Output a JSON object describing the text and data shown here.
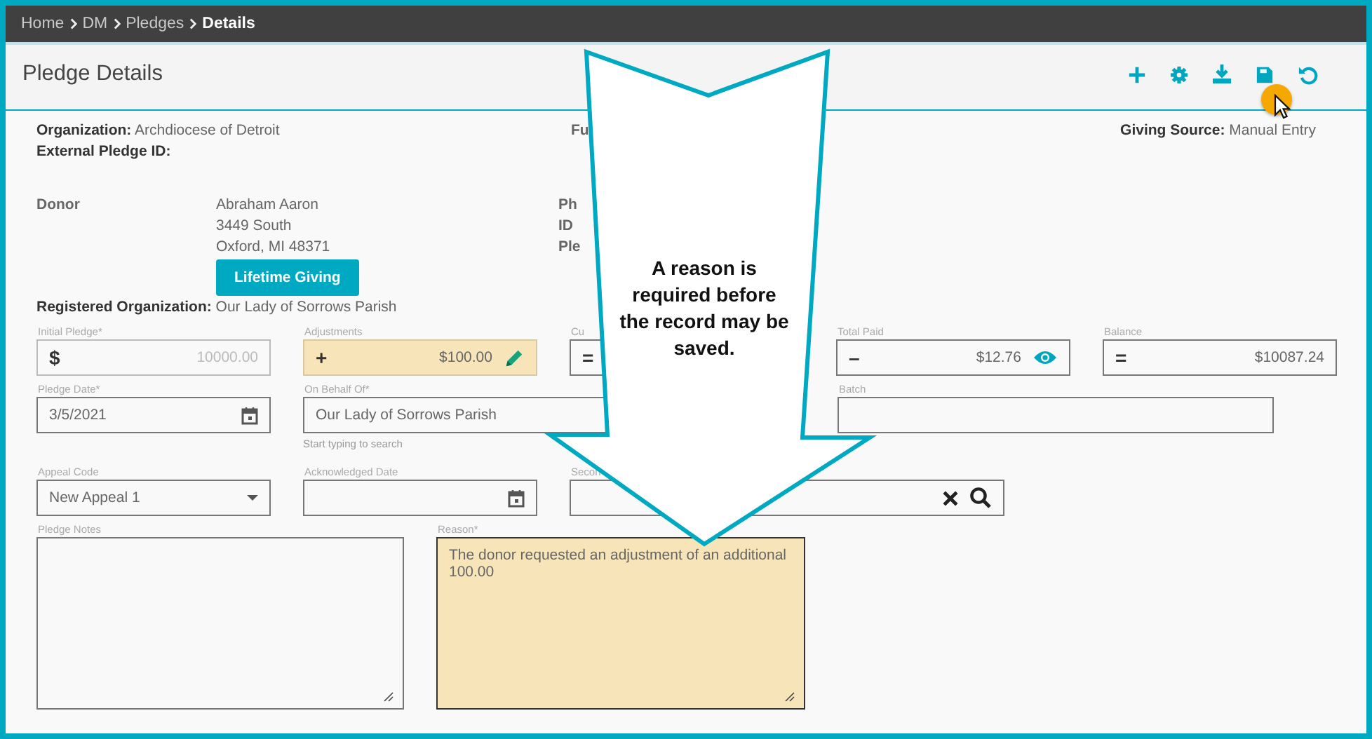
{
  "breadcrumb": [
    {
      "label": "Home",
      "current": false
    },
    {
      "label": "DM",
      "current": false
    },
    {
      "label": "Pledges",
      "current": false
    },
    {
      "label": "Details",
      "current": true
    }
  ],
  "page_title": "Pledge Details",
  "summary": {
    "organization": {
      "label": "Organization:",
      "value": "Archdiocese of Detroit"
    },
    "external_pledge_id": {
      "label": "External Pledge ID:"
    },
    "column_2_label": "Fu",
    "giving_source": {
      "label": "Giving Source:",
      "value": "Manual Entry"
    }
  },
  "donor": {
    "label": "Donor",
    "lines": [
      "Abraham Aaron",
      "3449 South",
      "Oxford, MI 48371"
    ],
    "button": "Lifetime Giving",
    "column_2_labels": [
      "Ph",
      "ID",
      "Ple"
    ]
  },
  "registered_organization": {
    "label": "Registered Organization:",
    "value": "Our Lady of Sorrows Parish"
  },
  "form_rows": [
    [
      {
        "kind": "amount",
        "label": "Initial Pledge*",
        "prefix": "$",
        "value": "10000.00",
        "disabled": true,
        "highlighted": false
      },
      {
        "kind": "amount_edit",
        "label": "Adjustments",
        "prefix": "+",
        "value": "$100.00",
        "disabled": false,
        "highlighted": true
      },
      {
        "kind": "amount",
        "label": "Cu",
        "prefix": "=",
        "disabled": false,
        "highlighted": false
      },
      {
        "kind": "amount_view",
        "label": "Total Paid",
        "prefix": "–",
        "value": "$12.76",
        "disabled": false,
        "highlighted": false
      },
      {
        "kind": "amount",
        "label": "Balance",
        "prefix": "=",
        "value": "$10087.24",
        "disabled": false,
        "highlighted": false
      }
    ],
    [
      {
        "kind": "date",
        "label": "Pledge Date*",
        "value": "3/5/2021",
        "disabled": false,
        "highlighted": false
      },
      {
        "kind": "text",
        "label": "On Behalf Of*",
        "value": "Our Lady of Sorrows Parish",
        "helper": "Start typing to search",
        "disabled": false,
        "highlighted": false
      },
      {
        "kind": "text",
        "label": "Batch",
        "disabled": false,
        "highlighted": false
      }
    ],
    [
      {
        "kind": "select",
        "label": "Appeal Code",
        "value": "New Appeal 1",
        "disabled": false,
        "highlighted": false
      },
      {
        "kind": "date",
        "label": "Acknowledged Date",
        "disabled": false,
        "highlighted": false
      },
      {
        "kind": "lookup",
        "label": "Secon",
        "disabled": false,
        "highlighted": false
      }
    ],
    [
      {
        "kind": "textarea",
        "label": "Pledge Notes",
        "disabled": false,
        "highlighted": false
      },
      {
        "kind": "textarea",
        "label": "Reason*",
        "value": "The donor requested an adjustment of an additional 100.00",
        "disabled": false,
        "highlighted": true
      }
    ]
  ],
  "callout": {
    "text": "A reason is required before the record may be saved."
  }
}
